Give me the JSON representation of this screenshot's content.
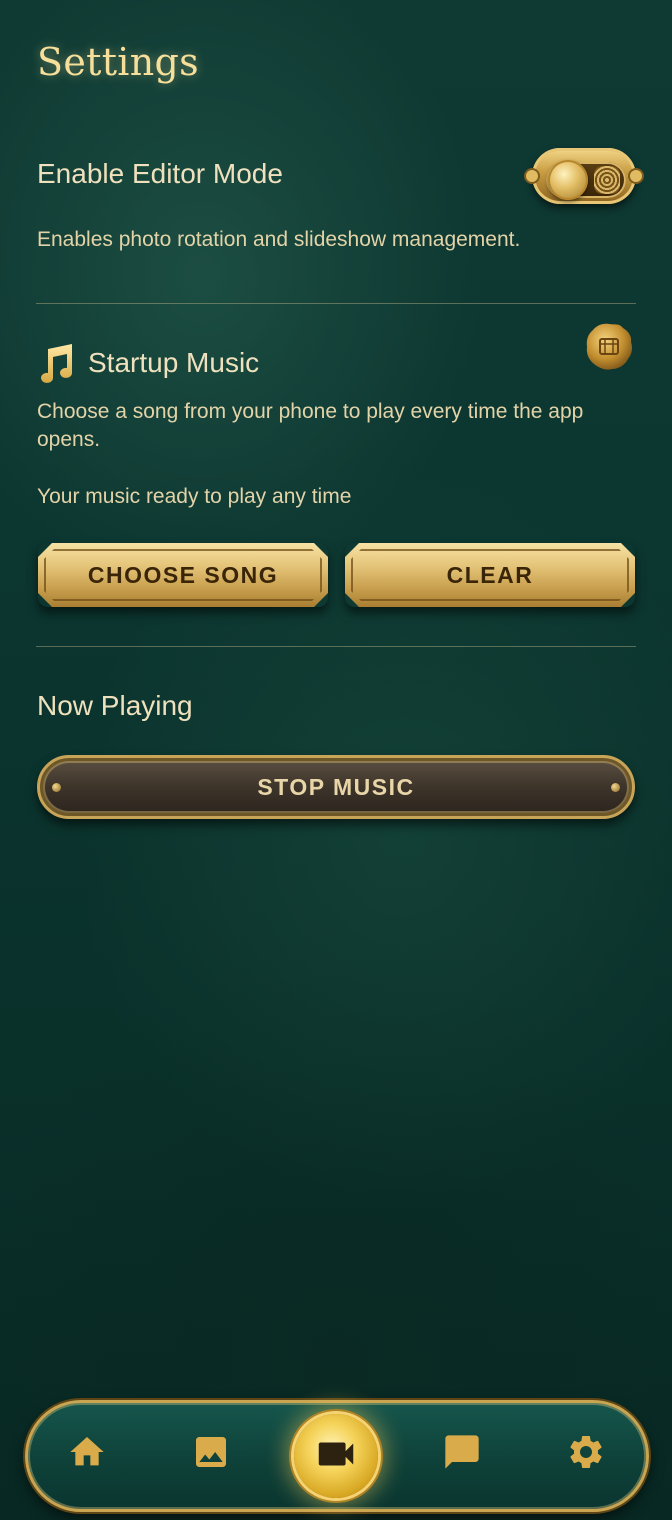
{
  "page": {
    "title": "Settings"
  },
  "editor_mode": {
    "title": "Enable Editor Mode",
    "description": "Enables photo rotation and slideshow management.",
    "toggle_state": "on"
  },
  "startup_music": {
    "title": "Startup Music",
    "description": "Choose a song from your phone to play every time the app opens.",
    "status": "Your music ready to play any time",
    "choose_label": "CHOOSE SONG",
    "clear_label": "CLEAR"
  },
  "now_playing": {
    "title": "Now Playing",
    "stop_label": "STOP MUSIC"
  },
  "nav": {
    "items": [
      {
        "icon": "home-icon",
        "active": false
      },
      {
        "icon": "image-icon",
        "active": false
      },
      {
        "icon": "video-camera-icon",
        "active": true
      },
      {
        "icon": "chat-icon",
        "active": false
      },
      {
        "icon": "gear-icon",
        "active": false
      }
    ]
  },
  "colors": {
    "background": "#0c3630",
    "gold": "#e5c57a",
    "text": "#eadbb5",
    "title": "#f6df9a"
  }
}
